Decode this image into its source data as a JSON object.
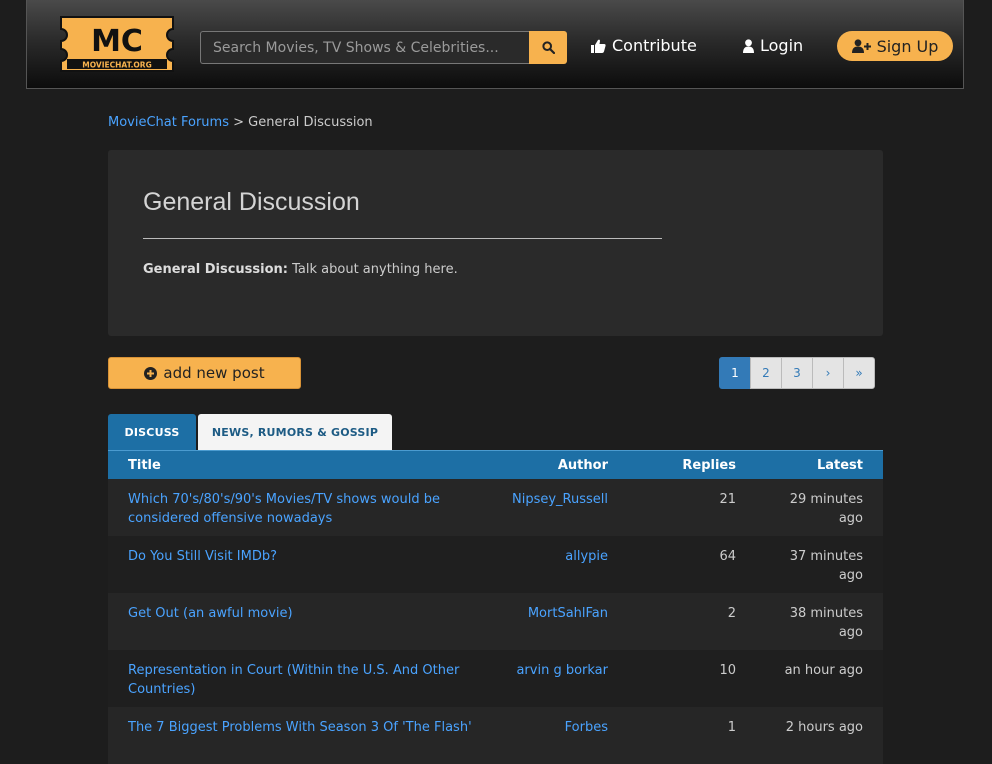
{
  "header": {
    "logo": {
      "letters": "MC",
      "sub": "MOVIECHAT.ORG"
    },
    "search": {
      "placeholder": "Search Movies, TV Shows & Celebrities..."
    },
    "nav": {
      "contribute": "Contribute",
      "login": "Login",
      "signup": "Sign Up"
    },
    "colors": {
      "accent": "#f7b24e"
    }
  },
  "breadcrumb": {
    "root": "MovieChat Forums",
    "separator": ">",
    "current": "General Discussion"
  },
  "forum": {
    "title": "General Discussion",
    "desc_label": "General Discussion:",
    "desc_text": "Talk about anything here."
  },
  "actions": {
    "add_post": "add new post"
  },
  "pagination": {
    "pages": [
      "1",
      "2",
      "3"
    ],
    "next": "›",
    "last": "»",
    "active": "1"
  },
  "tabs": {
    "discuss": "DISCUSS",
    "news": "NEWS, RUMORS & GOSSIP"
  },
  "table": {
    "headers": {
      "title": "Title",
      "author": "Author",
      "replies": "Replies",
      "latest": "Latest"
    },
    "rows": [
      {
        "title": "Which 70's/80's/90's Movies/TV shows would be considered offensive nowadays",
        "author": "Nipsey_Russell",
        "replies": "21",
        "latest": "29 minutes ago"
      },
      {
        "title": "Do You Still Visit IMDb?",
        "author": "allypie",
        "replies": "64",
        "latest": "37 minutes ago"
      },
      {
        "title": "Get Out (an awful movie)",
        "author": "MortSahlFan",
        "replies": "2",
        "latest": "38 minutes ago"
      },
      {
        "title": "Representation in Court (Within the U.S. And Other Countries)",
        "author": "arvin g borkar",
        "replies": "10",
        "latest": "an hour ago"
      },
      {
        "title": "The 7 Biggest Problems With Season 3 Of 'The Flash'",
        "author": "Forbes",
        "replies": "1",
        "latest": "2 hours ago"
      }
    ]
  }
}
